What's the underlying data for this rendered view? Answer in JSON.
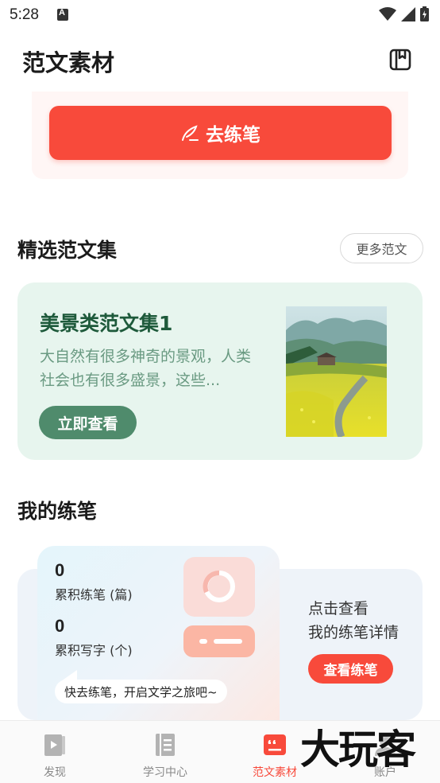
{
  "status_bar": {
    "time": "5:28"
  },
  "header": {
    "title": "范文素材"
  },
  "top_card": {
    "button_label": "去练笔"
  },
  "featured": {
    "section_title": "精选范文集",
    "more_label": "更多范文",
    "card": {
      "title": "美景类范文集1",
      "description": "大自然有很多神奇的景观，人类社会也有很多盛景，这些...",
      "button_label": "立即查看"
    }
  },
  "my_practice": {
    "section_title": "我的练笔",
    "stats": [
      {
        "value": "0",
        "label": "累积练笔 (篇)"
      },
      {
        "value": "0",
        "label": "累积写字 (个)"
      }
    ],
    "bubble_text": "快去练笔，开启文学之旅吧~",
    "prompt_line1": "点击查看",
    "prompt_line2": "我的练笔详情",
    "button_label": "查看练笔"
  },
  "tab_bar": {
    "tabs": [
      {
        "label": "发现",
        "icon": "video-book-icon",
        "active": false
      },
      {
        "label": "学习中心",
        "icon": "notebook-icon",
        "active": false
      },
      {
        "label": "范文素材",
        "icon": "quote-icon",
        "active": true
      },
      {
        "label": "账户",
        "icon": "user-icon",
        "active": false
      }
    ]
  },
  "watermark": "大玩客",
  "colors": {
    "accent": "#f84a3b",
    "green_card": "#e7f5ee",
    "green_button": "#4f8b6c",
    "green_title": "#1e5a3b"
  }
}
